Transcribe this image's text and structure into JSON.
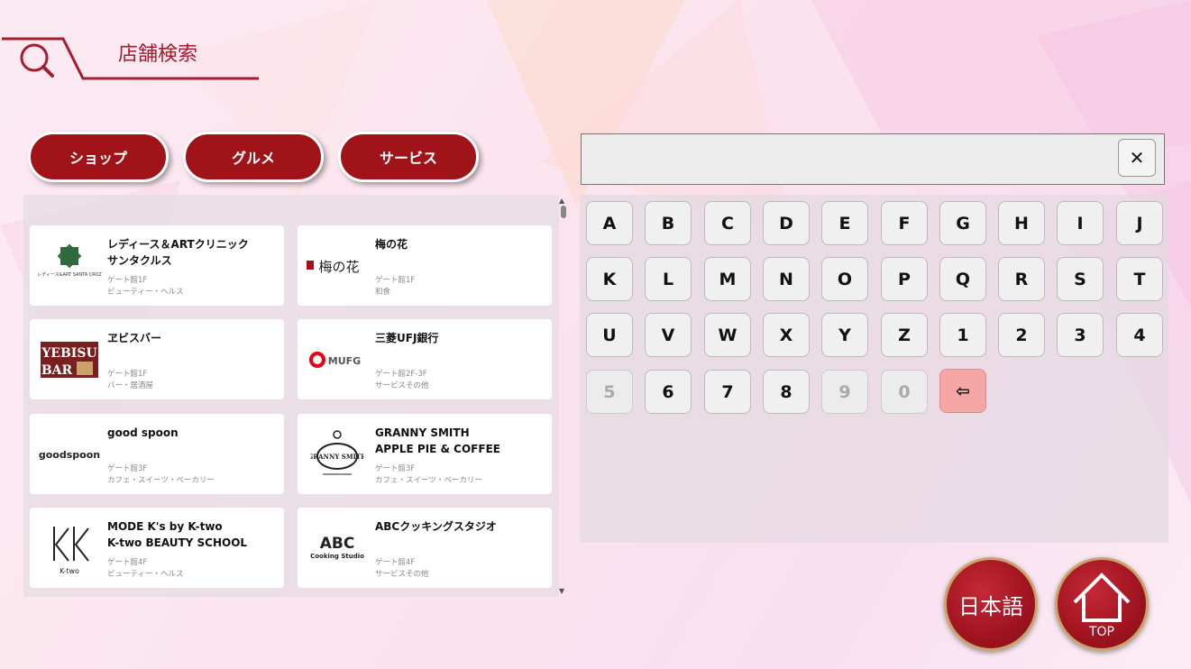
{
  "header": {
    "title": "店舗検索",
    "icon": "search-icon"
  },
  "categories": [
    "ショップ",
    "グルメ",
    "サービス"
  ],
  "stores": [
    {
      "name": "レディース＆ARTクリニック\nサンタクルス",
      "floor": "ゲート館1F",
      "category": "ビューティー・ヘルス",
      "logo_text": "レディース&ART SANTA CRUZ"
    },
    {
      "name": "梅の花",
      "floor": "ゲート館1F",
      "category": "和食",
      "logo_text": "梅の花"
    },
    {
      "name": "ヱビスバー",
      "floor": "ゲート館1F",
      "category": "バー・居酒屋",
      "logo_text": "YEBISU BAR"
    },
    {
      "name": "三菱UFJ銀行",
      "floor": "ゲート館2F-3F",
      "category": "サービスその他",
      "logo_text": "MUFG"
    },
    {
      "name": "good spoon",
      "floor": "ゲート館3F",
      "category": "カフェ・スイーツ・ベーカリー",
      "logo_text": "goodspoon"
    },
    {
      "name": "GRANNY SMITH\nAPPLE PIE & COFFEE",
      "floor": "ゲート館3F",
      "category": "カフェ・スイーツ・ベーカリー",
      "logo_text": "GRANNY SMITH"
    },
    {
      "name": "MODE K's by K-two\nK-two BEAUTY SCHOOL",
      "floor": "ゲート館4F",
      "category": "ビューティー・ヘルス",
      "logo_text": "K-two"
    },
    {
      "name": "ABCクッキングスタジオ",
      "floor": "ゲート館4F",
      "category": "サービスその他",
      "logo_text": "ABC Cooking Studio"
    }
  ],
  "search": {
    "value": "",
    "clear_label": "✕"
  },
  "keyboard": {
    "rows": [
      [
        "A",
        "B",
        "C",
        "D",
        "E",
        "F",
        "G",
        "H",
        "I",
        "J"
      ],
      [
        "K",
        "L",
        "M",
        "N",
        "O",
        "P",
        "Q",
        "R",
        "S",
        "T"
      ],
      [
        "U",
        "V",
        "W",
        "X",
        "Y",
        "Z",
        "1",
        "2",
        "3",
        "4"
      ],
      [
        "5",
        "6",
        "7",
        "8",
        "9",
        "0"
      ]
    ],
    "disabled": [
      "5",
      "9",
      "0"
    ],
    "backspace_label": "⇦"
  },
  "buttons": {
    "language": "日本語",
    "top": "TOP"
  },
  "colors": {
    "primary": "#a01318",
    "accent": "#a51c2e",
    "backspace": "#f7a6a6"
  }
}
